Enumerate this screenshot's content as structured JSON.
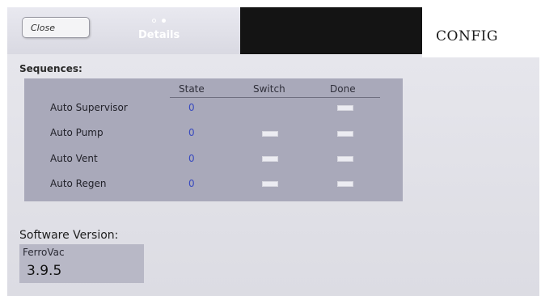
{
  "header": {
    "close_label": "Close",
    "page_indicator": {
      "total": 2,
      "active": 2
    },
    "details_label": "Details",
    "config_label": "CONFIG"
  },
  "sequences": {
    "title": "Sequences:",
    "columns": [
      "State",
      "Switch",
      "Done"
    ],
    "rows": [
      {
        "label": "Auto Supervisor",
        "state": "0",
        "switch": false,
        "done": true
      },
      {
        "label": "Auto Pump",
        "state": "0",
        "switch": true,
        "done": true
      },
      {
        "label": "Auto Vent",
        "state": "0",
        "switch": true,
        "done": true
      },
      {
        "label": "Auto Regen",
        "state": "0",
        "switch": true,
        "done": true
      }
    ]
  },
  "software": {
    "title": "Software Version:",
    "name": "FerroVac",
    "version": "3.9.5"
  },
  "colors": {
    "state_value": "#3a4bbf",
    "table_bg": "#a9a9ba",
    "panel_bg": "#dcdce3"
  }
}
